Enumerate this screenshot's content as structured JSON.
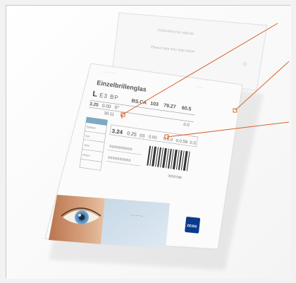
{
  "paper_label": {
    "header_line1": "Instructions for optician",
    "header_line2": "Please note lens data below"
  },
  "label": {
    "title": "Einzelbrillenglas",
    "lens_code": "L",
    "lens_code_mid": "E3 BP",
    "row_values": [
      "BS.CA",
      "103",
      "79.27",
      "60.5"
    ],
    "row2": [
      "3.25",
      "0.00",
      "0°"
    ],
    "row3": [
      "30.11"
    ],
    "row3_right": "0.0",
    "table_left_labels": [
      "Sphere",
      "Cyl",
      "Axis",
      "Prism"
    ],
    "prescription": [
      "3.24",
      "0.25",
      "(0)",
      "0.00"
    ],
    "table_right": [
      "0.6.0",
      "0.0.59",
      "0.3"
    ],
    "codes": [
      "0000000000",
      "0000000000"
    ],
    "barcode_caption": "0000788",
    "brand_text": "ZEISS"
  },
  "colors": {
    "callout_line": "#d9642b",
    "zeiss_blue": "#0a3a8a",
    "eye_iris": "#4a8fc4"
  }
}
